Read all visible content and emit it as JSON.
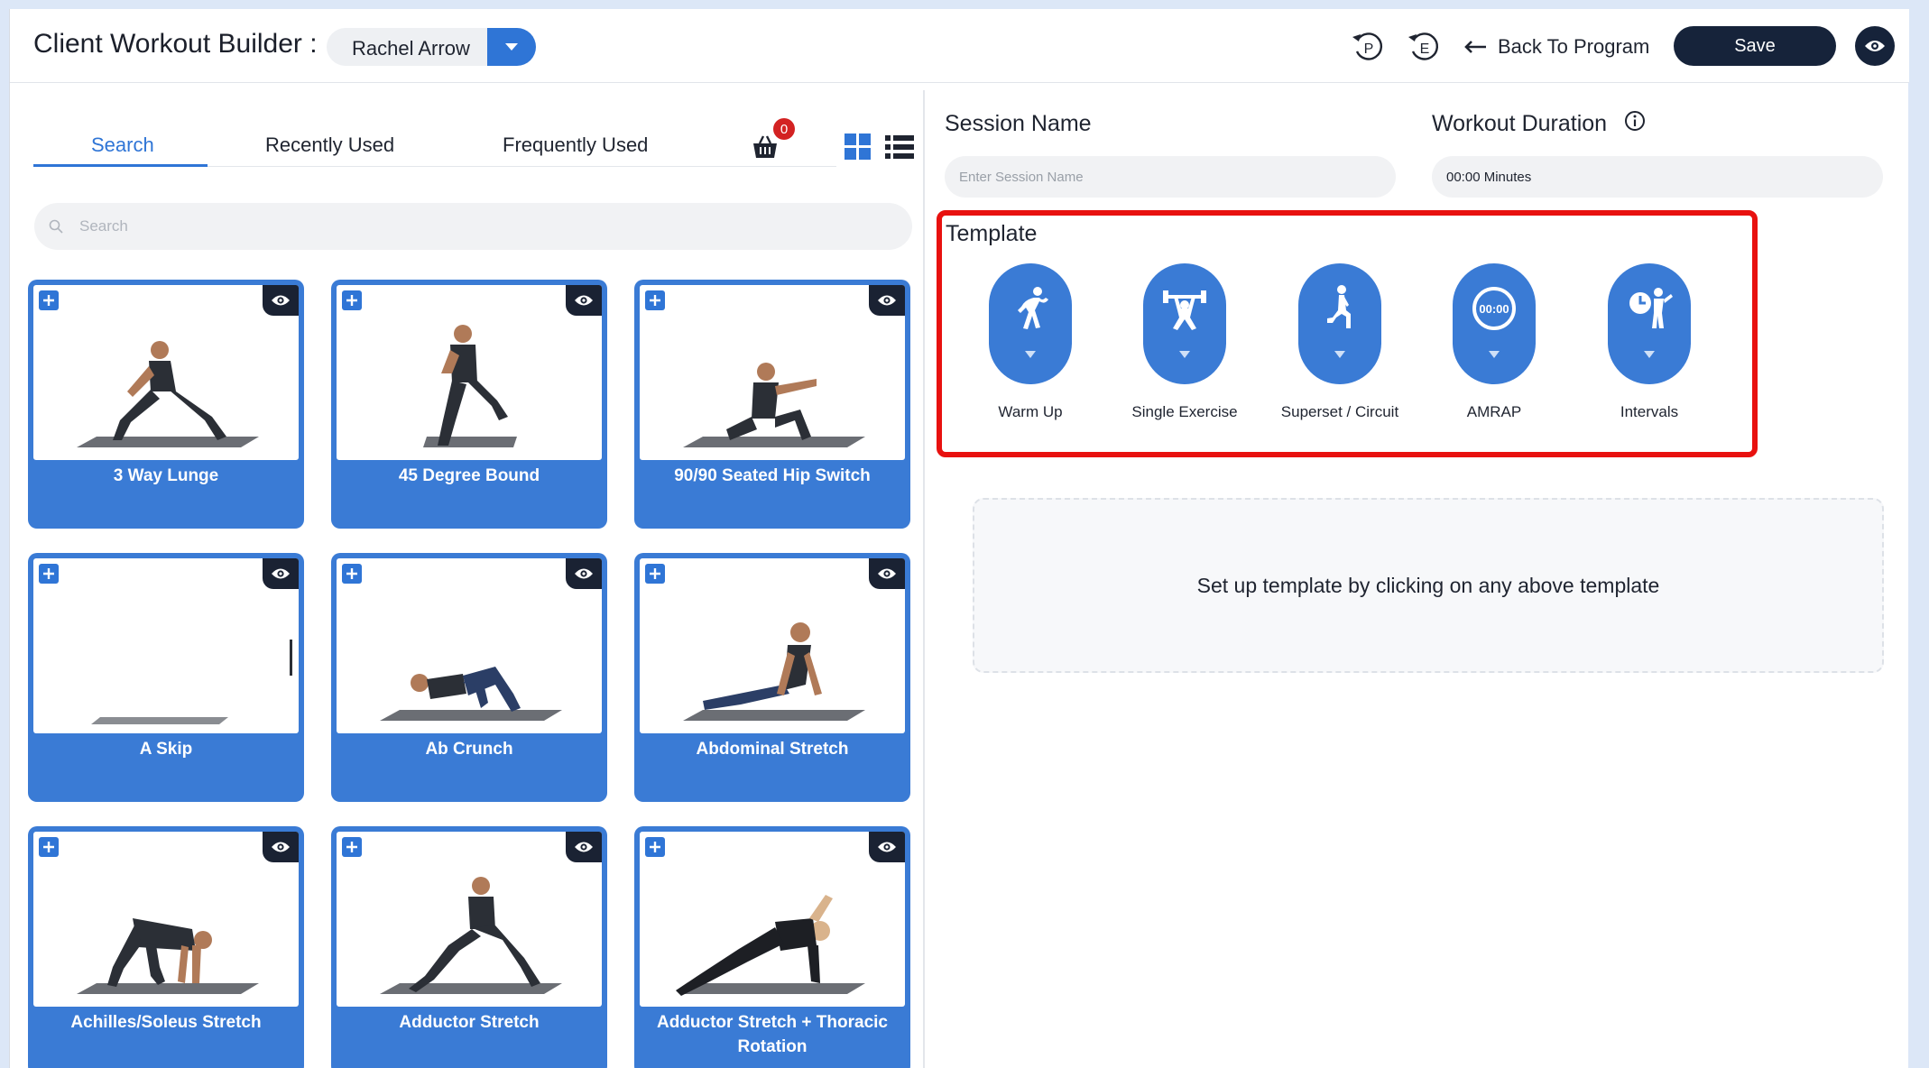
{
  "header": {
    "title": "Client Workout Builder :",
    "client_name": "Rachel Arrow",
    "undo_p_label": "P",
    "undo_e_label": "E",
    "back_label": "Back To Program",
    "save_label": "Save"
  },
  "library": {
    "tabs": [
      {
        "label": "Search",
        "active": true
      },
      {
        "label": "Recently Used",
        "active": false
      },
      {
        "label": "Frequently Used",
        "active": false
      }
    ],
    "basket_count": "0",
    "search_placeholder": "Search",
    "exercises": [
      {
        "name": "3 Way Lunge",
        "pose": "lunge"
      },
      {
        "name": "45 Degree Bound",
        "pose": "bound"
      },
      {
        "name": "90/90 Seated Hip Switch",
        "pose": "seated"
      },
      {
        "name": "A Skip",
        "pose": "empty"
      },
      {
        "name": "Ab Crunch",
        "pose": "crunch"
      },
      {
        "name": "Abdominal Stretch",
        "pose": "cobra"
      },
      {
        "name": "Achilles/Soleus Stretch",
        "pose": "bear"
      },
      {
        "name": "Adductor Stretch",
        "pose": "sidelunge"
      },
      {
        "name": "Adductor Stretch + Thoracic Rotation",
        "pose": "rotation"
      }
    ]
  },
  "session": {
    "name_label": "Session Name",
    "name_placeholder": "Enter Session Name",
    "duration_label": "Workout Duration",
    "duration_value": "00:00 Minutes"
  },
  "template": {
    "title": "Template",
    "items": [
      {
        "label": "Warm Up",
        "icon": "stretch-icon"
      },
      {
        "label": "Single Exercise",
        "icon": "weightlift-icon"
      },
      {
        "label": "Superset / Circuit",
        "icon": "lunge-icon"
      },
      {
        "label": "AMRAP",
        "icon": "timer-icon",
        "timer_text": "00:00"
      },
      {
        "label": "Intervals",
        "icon": "interval-clock-icon"
      }
    ],
    "empty_message": "Set up template by clicking on any above template"
  },
  "colors": {
    "accent": "#2f75d6",
    "card_blue": "#3a7bd5",
    "dark": "#16233a",
    "highlight": "#e8110f",
    "badge": "#d32222"
  }
}
